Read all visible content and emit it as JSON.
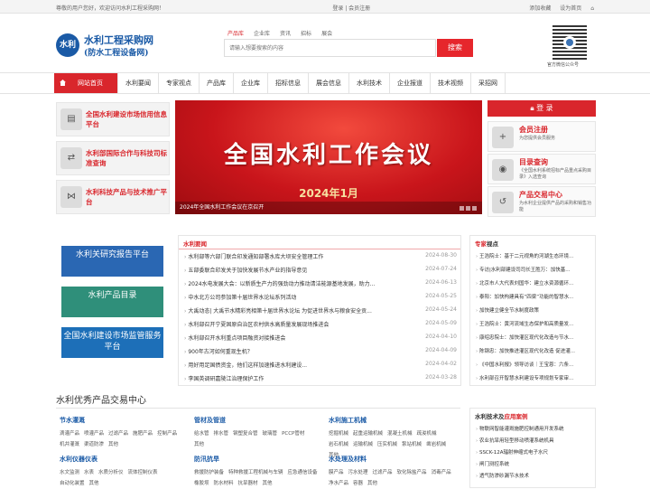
{
  "topbar": {
    "welcome": "尊敬的用户您好，欢迎访问水利工程采购网！",
    "login_register": "登录 | 会员注册",
    "favorite": "添加收藏",
    "homepage": "设为首页"
  },
  "logo": {
    "emblem": "水利",
    "line1": "水利工程采购网",
    "line2": "(防水工程设备网)"
  },
  "search": {
    "tabs": [
      "产品库",
      "企业库",
      "资讯",
      "招标",
      "展会"
    ],
    "active_tab": 0,
    "placeholder": "请输入想要搜索的内容",
    "button": "搜索"
  },
  "qr": {
    "caption": "官方微信公众号"
  },
  "nav": {
    "home": "网站首页",
    "items": [
      "水利要闻",
      "专家视点",
      "产品库",
      "企业库",
      "招标信息",
      "展会信息",
      "水利技术",
      "企业报道",
      "技术视频",
      "采招网"
    ]
  },
  "left_links": [
    {
      "icon": "report-icon",
      "glyph": "▤",
      "label": "全国水利建设市场信用信息平台"
    },
    {
      "icon": "handshake-icon",
      "glyph": "⇄",
      "label": "水利部国际合作与科技司标准查询"
    },
    {
      "icon": "share-icon",
      "glyph": "⋈",
      "label": "水利科技产品与技术推广平台"
    }
  ],
  "banner": {
    "title": "全国水利工作会议",
    "date": "2024年1月",
    "caption": "2024年全国水利工作会议在京召开"
  },
  "member": {
    "login": "登 录",
    "boxes": [
      {
        "icon": "user-add-icon",
        "glyph": "+",
        "title": "会员注册",
        "sub": "为您提供会员服务"
      },
      {
        "icon": "catalog-icon",
        "glyph": "◉",
        "title": "目录查询",
        "sub": "《全国水利系统招标产品重点采购目录》入选查询"
      },
      {
        "icon": "trade-icon",
        "glyph": "↺",
        "title": "产品交易中心",
        "sub": "为水利企业提供产品的采购和销售功能"
      }
    ]
  },
  "promos": [
    {
      "label": "水利关研究报告平台",
      "color": "#2a67b3"
    },
    {
      "label": "水利产品目录",
      "color": "#2f8f7a"
    },
    {
      "label": "全国水利建设市场监管服务平台",
      "color": "#1d6fb8"
    }
  ],
  "news": {
    "heading_a": "水利",
    "heading_b": "要闻",
    "rows": [
      {
        "title": "水利部等六部门联合印发通知部署水库大坝安全管理工作",
        "date": "2024-08-30"
      },
      {
        "title": "五部委联合印发关于加快发展节水产业的指导意见",
        "date": "2024-07-24"
      },
      {
        "title": "2024水电发展大会：以新质生产力的强劲动力推动清洁能源基地发展，助力...",
        "date": "2024-06-13"
      },
      {
        "title": "中水北方公司参加第十届世界水论坛系列活动",
        "date": "2024-05-25"
      },
      {
        "title": "大禹动态| 大禹节水精彩亮相第十届世界水论坛 为促进世界水与粮食安全贡...",
        "date": "2024-05-24"
      },
      {
        "title": "水利部召开宁夏固原自治区农村供水高质量发展现场推进会",
        "date": "2024-05-09"
      },
      {
        "title": "水利部召开水利重点项目融资对接推进会",
        "date": "2024-04-10"
      },
      {
        "title": "900年古河如何重现生机？",
        "date": "2024-04-09"
      },
      {
        "title": "用好用足国债资金，他们这样加速推进水利建设...",
        "date": "2024-04-02"
      },
      {
        "title": "李国英调研嘉陵江治理保护工作",
        "date": "2024-03-28"
      }
    ]
  },
  "experts": {
    "heading_a": "专家",
    "heading_b": "视点",
    "rows": [
      "王浩院士：基于二元视角的河湖生态环境...",
      "专访|水利部建设司司长王胜万：加快基...",
      "北京市人大代表刘国华：建立水资源循环...",
      "泰阳：加快构建具有“四梁”功能的智慧水...",
      "加快建立健全节水制度政策",
      "王浩院士：黄河流域生态保护和高质量发...",
      "康绍忠院士：加快灌区现代化改造与节水...",
      "陈钢忠：加快推进灌区现代化改造 促进灌...",
      "《中国水利报》领导访谈｜王宝恩：六条...",
      "水利部召开智慧水利建设专项规划专家审..."
    ]
  },
  "market": {
    "title": "水利优秀产品交易中心",
    "categories": [
      {
        "name": "节水灌溉",
        "items": [
          "滴灌产品",
          "喷灌产品",
          "过滤产品",
          "施肥产品",
          "控制产品",
          "机井灌溉",
          "渠道防渗",
          "其他"
        ]
      },
      {
        "name": "管材及管道",
        "items": [
          "给水管",
          "排水管",
          "钢塑复合管",
          "玻璃管",
          "PCCP管材",
          "其他"
        ]
      },
      {
        "name": "水利施工机械",
        "items": [
          "挖掘机械",
          "起重运输机械",
          "混凝土机械",
          "疏浚机械",
          "岩石机械",
          "运输机械",
          "压实机械",
          "泵站机械",
          "凿岩机械",
          "其他"
        ]
      },
      {
        "name": "水利仪器仪表",
        "items": [
          "水文监测",
          "水表",
          "水质分析仪",
          "流体控制仪表",
          "自动化装置",
          "其他"
        ]
      },
      {
        "name": "防汛抗旱",
        "items": [
          "救援防护装备",
          "特种救援工程机械与车辆",
          "应急通信设备",
          "橡胶坝",
          "防水材料",
          "抗旱器材",
          "其他"
        ]
      },
      {
        "name": "水处理及材料",
        "items": [
          "膜产品",
          "污水处理",
          "过滤产品",
          "软化除盐产品",
          "消毒产品",
          "净水产品",
          "容器",
          "其他"
        ]
      }
    ]
  },
  "cases": {
    "heading_a": "水利技术及",
    "heading_b": "应用案例",
    "rows": [
      "物联网智能灌溉施肥控制通用开发系统",
      "农业抗旱用轻型移动喷灌系统机具",
      "SSCK-12A辐射伸缩式电子水尺",
      "闸门测控系统",
      "透气防渗砂漏节水技术"
    ]
  }
}
